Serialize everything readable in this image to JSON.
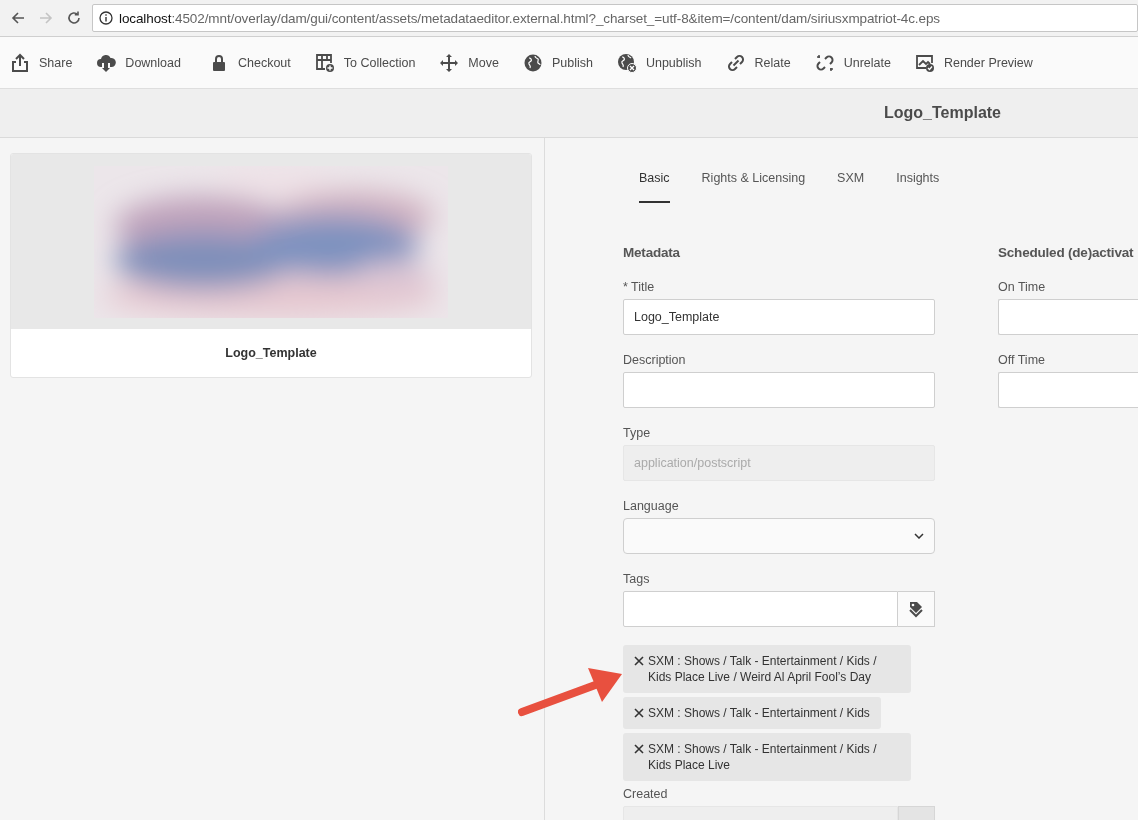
{
  "browser": {
    "nav": [
      {
        "kind": "back",
        "disabled": false
      },
      {
        "kind": "forward",
        "disabled": true
      },
      {
        "kind": "reload",
        "disabled": false
      }
    ],
    "url_host": "localhost",
    "url_rest": ":4502/mnt/overlay/dam/gui/content/assets/metadataeditor.external.html?_charset_=utf-8&item=/content/dam/siriusxmpatriot-4c.eps"
  },
  "toolbar": [
    {
      "label": "Share",
      "kind": "share"
    },
    {
      "label": "Download",
      "kind": "download"
    },
    {
      "label": "Checkout",
      "kind": "lock"
    },
    {
      "label": "To Collection",
      "kind": "collection"
    },
    {
      "label": "Move",
      "kind": "move"
    },
    {
      "label": "Publish",
      "kind": "globe"
    },
    {
      "label": "Unpublish",
      "kind": "globex"
    },
    {
      "label": "Relate",
      "kind": "link"
    },
    {
      "label": "Unrelate",
      "kind": "unlink"
    },
    {
      "label": "Render Preview",
      "kind": "render"
    }
  ],
  "header": {
    "title": "Logo_Template"
  },
  "asset": {
    "kind": "picture",
    "name": "Logo_Template"
  },
  "tabs": [
    {
      "label": "Basic",
      "selected": true
    },
    {
      "label": "Rights & Licensing",
      "selected": false
    },
    {
      "label": "SXM",
      "selected": false
    },
    {
      "label": "Insights",
      "selected": false
    }
  ],
  "metadata": {
    "heading": "Metadata",
    "fields": [
      {
        "kind": "text",
        "label": "* Title",
        "value": "Logo_Template"
      },
      {
        "kind": "text",
        "label": "Description"
      },
      {
        "kind": "readonly",
        "label": "Type",
        "value": "application/postscript"
      },
      {
        "kind": "select",
        "label": "Language"
      },
      {
        "kind": "tags",
        "label": "Tags",
        "tags": [
          "SXM : Shows / Talk - Entertainment / Kids / Kids Place Live / Weird Al April Fool’s Day",
          "SXM : Shows / Talk - Entertainment / Kids",
          "SXM : Shows / Talk - Entertainment / Kids / Kids Place Live"
        ]
      },
      {
        "kind": "date",
        "label": "Created"
      }
    ]
  },
  "schedule": {
    "heading": "Scheduled (de)activat",
    "fields": [
      {
        "kind": "text",
        "label": "On Time"
      },
      {
        "kind": "text",
        "label": "Off Time"
      }
    ]
  }
}
